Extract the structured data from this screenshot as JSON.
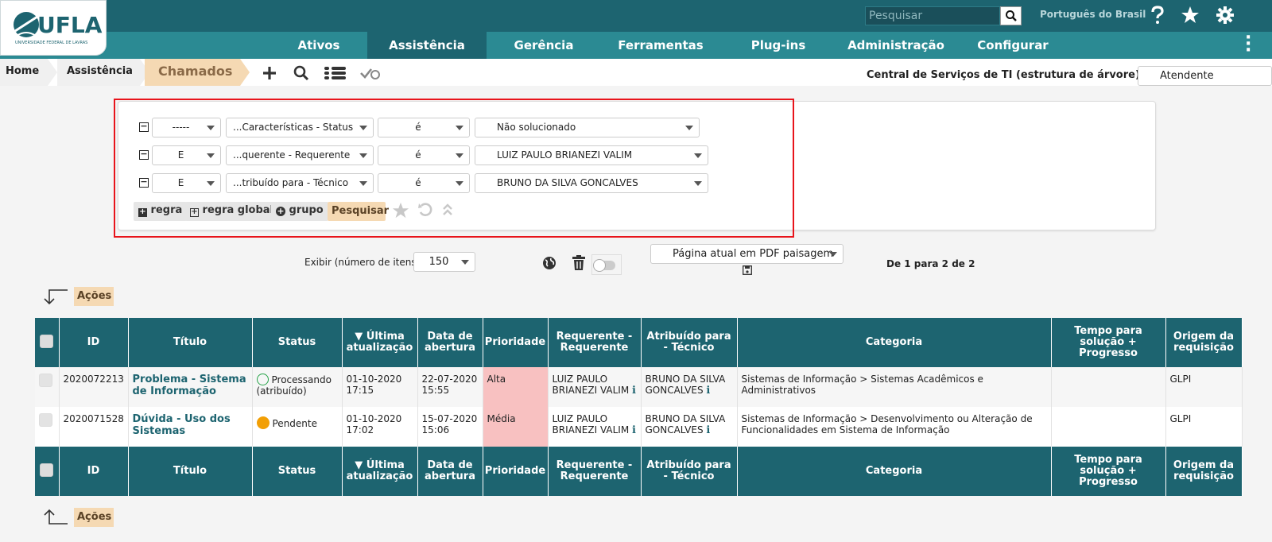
{
  "header": {
    "logo_text": "UFLA",
    "logo_subtitle": "UNIVERSIDADE FEDERAL DE LAVRAS",
    "search_placeholder": "Pesquisar",
    "language": "Português do Brasil",
    "icons": [
      "search-icon",
      "help-icon",
      "star-icon",
      "gear-icon"
    ]
  },
  "nav": {
    "items": [
      {
        "label": "Ativos"
      },
      {
        "label": "Assistência"
      },
      {
        "label": "Gerência"
      },
      {
        "label": "Ferramentas"
      },
      {
        "label": "Plug-ins"
      },
      {
        "label": "Administração"
      },
      {
        "label": "Configurar"
      }
    ],
    "active": "Assistência"
  },
  "breadcrumb": {
    "home": "Home",
    "section": "Assistência",
    "current": "Chamados"
  },
  "toolbar_icons": [
    "add-icon",
    "search-icon",
    "list-icon",
    "approve-icon"
  ],
  "entity": {
    "name": "Central de Serviços de TI (estrutura de árvore)",
    "profile": "Atendente"
  },
  "criteria": [
    {
      "link": "-----",
      "field": "...Características - Status",
      "operator": "é",
      "value": "Não solucionado"
    },
    {
      "link": "E",
      "field": "...querente - Requerente",
      "operator": "é",
      "value": "LUIZ PAULO BRIANEZI VALIM"
    },
    {
      "link": "E",
      "field": "...tribuído para - Técnico",
      "operator": "é",
      "value": "BRUNO DA SILVA GONCALVES"
    }
  ],
  "search_buttons": {
    "rule": "regra",
    "global_rule": "regra global",
    "group": "grupo",
    "search": "Pesquisar"
  },
  "list_controls": {
    "display_label": "Exibir (número de itens)",
    "display_value": "150",
    "export_option": "Página atual em PDF paisagem",
    "pagination": "De 1 para 2 de 2"
  },
  "actions_label": "Ações",
  "table": {
    "columns": [
      "ID",
      "Título",
      "Status",
      "▼ Última atualização",
      "Data de abertura",
      "Prioridade",
      "Requerente - Requerente",
      "Atribuído para - Técnico",
      "Categoria",
      "Tempo para solução + Progresso",
      "Origem da requisição"
    ],
    "rows": [
      {
        "id": "2020072213",
        "title": "Problema - Sistema de Informação",
        "status": "Processando (atribuído)",
        "updated": "01-10-2020 17:15",
        "opened": "22-07-2020 15:55",
        "priority": "Alta",
        "requester": "LUIZ PAULO BRIANEZI VALIM",
        "assigned": "BRUNO DA SILVA GONCALVES",
        "category": "Sistemas de Informação > Sistemas Acadêmicos e Administrativos",
        "time": "",
        "origin": "GLPI"
      },
      {
        "id": "2020071528",
        "title": "Dúvida - Uso dos Sistemas",
        "status": "Pendente",
        "updated": "01-10-2020 17:02",
        "opened": "15-07-2020 15:06",
        "priority": "Média",
        "requester": "LUIZ PAULO BRIANEZI VALIM",
        "assigned": "BRUNO DA SILVA GONCALVES",
        "category": "Sistemas de Informação > Desenvolvimento ou Alteração de Funcionalidades em Sistema de Informação",
        "time": "",
        "origin": "GLPI"
      }
    ]
  },
  "colors": {
    "primary": "#1d6470",
    "nav": "#2b8a93",
    "accent": "#f5d9b3",
    "priority_high": "#f8c1c1",
    "highlight_outline": "#e8141b",
    "status_processing": "#26a348",
    "status_pending": "#f29f05"
  }
}
